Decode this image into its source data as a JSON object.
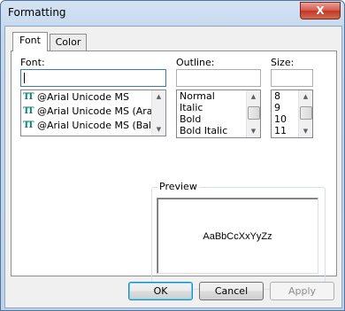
{
  "window": {
    "title": "Formatting",
    "close_glyph": "X"
  },
  "tabs": [
    {
      "label": "Font",
      "active": true
    },
    {
      "label": "Color",
      "active": false
    }
  ],
  "font": {
    "label": "Font:",
    "value": "",
    "items": [
      "@Arial Unicode MS",
      "@Arial Unicode MS (Arabic",
      "@Arial Unicode MS (Baltic)"
    ],
    "item_icon": "truetype-font-icon"
  },
  "outline": {
    "label": "Outline:",
    "value": "",
    "items": [
      "Normal",
      "Italic",
      "Bold",
      "Bold Italic"
    ]
  },
  "size": {
    "label": "Size:",
    "value": "",
    "items": [
      "8",
      "9",
      "10",
      "11"
    ]
  },
  "preview": {
    "label": "Preview",
    "sample": "AaBbCcXxYyZz"
  },
  "buttons": {
    "ok": "OK",
    "cancel": "Cancel",
    "apply": "Apply"
  },
  "colors": {
    "frame": "#c3d6ec",
    "close": "#c13626",
    "icon_tt": "#147a7a"
  }
}
